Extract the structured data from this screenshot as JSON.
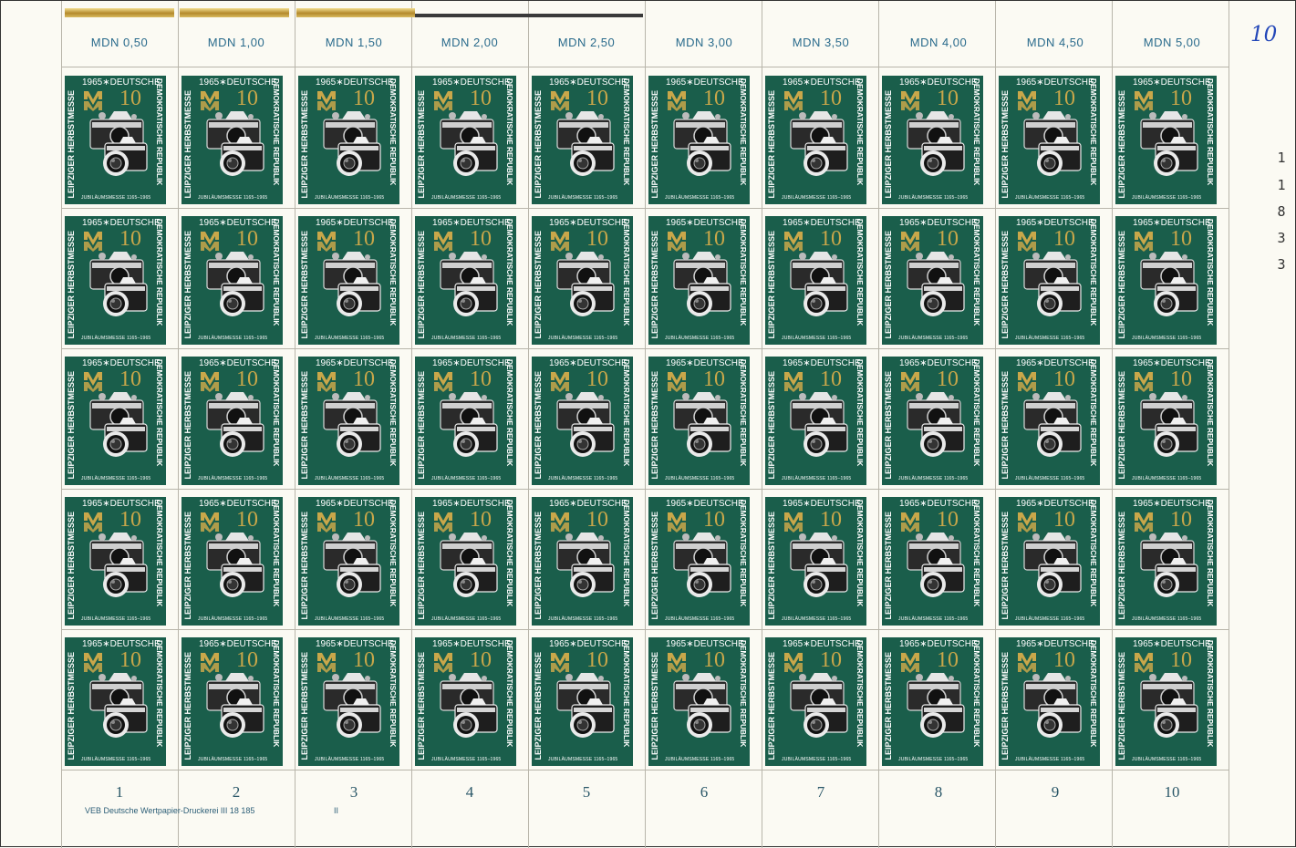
{
  "sheet": {
    "value_labels": [
      "MDN 0,50",
      "MDN 1,00",
      "MDN 1,50",
      "MDN 2,00",
      "MDN 2,50",
      "MDN 3,00",
      "MDN 3,50",
      "MDN 4,00",
      "MDN 4,50",
      "MDN 5,00"
    ],
    "column_numbers": [
      "1",
      "2",
      "3",
      "4",
      "5",
      "6",
      "7",
      "8",
      "9",
      "10"
    ],
    "control_number_digits": [
      "3",
      "3",
      "8",
      "1",
      "1"
    ],
    "handwritten_note": "10",
    "printer_imprint": "VEB Deutsche Wertpapier-Druckerei   III 18 185",
    "plate_mark": "II",
    "rows": 5,
    "columns": 10
  },
  "stamp": {
    "year_country": "1965∗DEUTSCHE",
    "country_vertical": "DEMOKRATISCHE REPUBLIK",
    "fair_vertical": "LEIPZIGER HERBSTMESSE",
    "denomination": "10",
    "jubilee_line": "JUBILÄUMSMESSE 1165–1965",
    "logo_icon": "leipzig-mm-logo",
    "image_icon": "camera-icon"
  },
  "colors": {
    "stamp_green": "#1a5e4b",
    "gold": "#c9a74a",
    "margin_text_blue": "#2a6b8c",
    "handwritten_blue": "#2347b8",
    "paper": "#fbfaf3"
  }
}
